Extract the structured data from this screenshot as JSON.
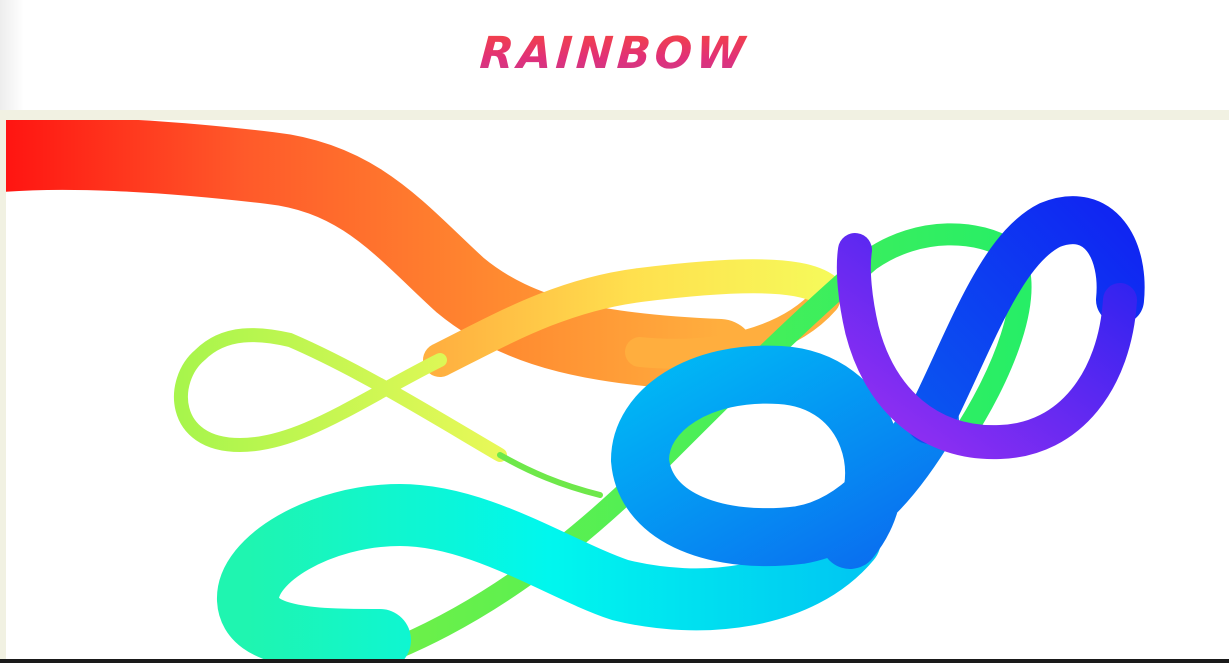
{
  "app": {
    "title": "RAINBOW"
  },
  "canvas": {
    "tool": "rainbow-brush",
    "stroke_colors": [
      "#ff1a1a",
      "#ff6a2a",
      "#ffa63a",
      "#f4f75a",
      "#a9f550",
      "#27f36e",
      "#00f7e4",
      "#00c9f0",
      "#0a74f0",
      "#0d2cf0",
      "#5b25ee",
      "#9b30f0"
    ]
  }
}
